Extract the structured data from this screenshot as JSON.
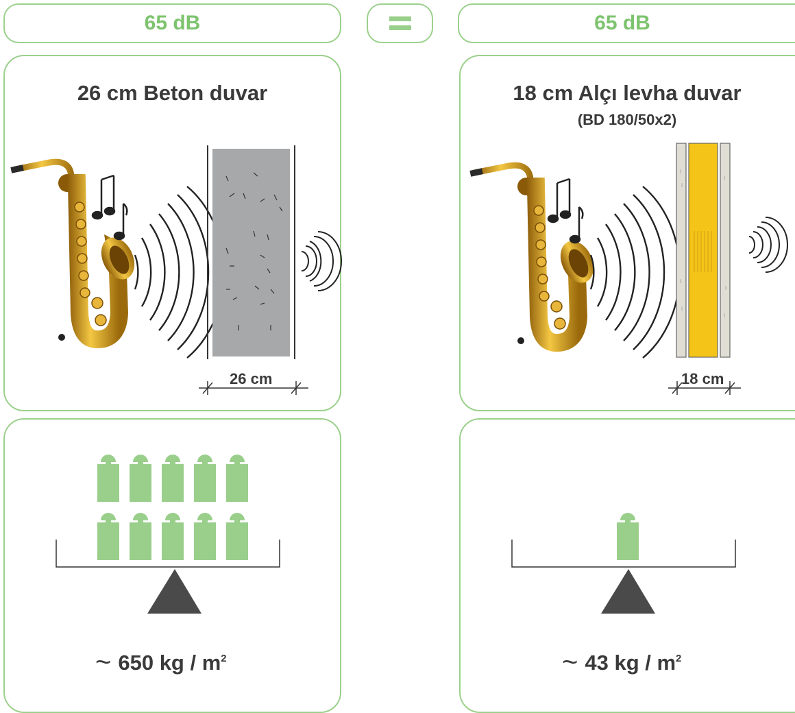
{
  "left": {
    "db_label": "65 dB",
    "wall_title": "26 cm Beton duvar",
    "dimension": "26 cm",
    "weight_prefix": "~",
    "weight_value": "650 kg / m",
    "weight_sup": "2",
    "weight_blocks": 10
  },
  "equals": "=",
  "right": {
    "db_label": "65 dB",
    "wall_title": "18 cm Alçı levha duvar",
    "wall_subtitle": "(BD 180/50x2)",
    "dimension": "18 cm",
    "weight_prefix": "~",
    "weight_value": "43 kg / m",
    "weight_sup": "2",
    "weight_blocks": 1
  },
  "colors": {
    "border": "#9bd08c",
    "accent_text": "#7dc36e",
    "weight_fill": "#99cf8b",
    "dark": "#4a4a4a",
    "concrete": "#a7a8aa",
    "insulation": "#f4c418",
    "board": "#e0ded4",
    "sax_gold": "#d9a424"
  },
  "icons": [
    "saxophone-icon",
    "music-note-icon",
    "sound-wave-icon",
    "weight-icon",
    "balance-scale-icon"
  ]
}
